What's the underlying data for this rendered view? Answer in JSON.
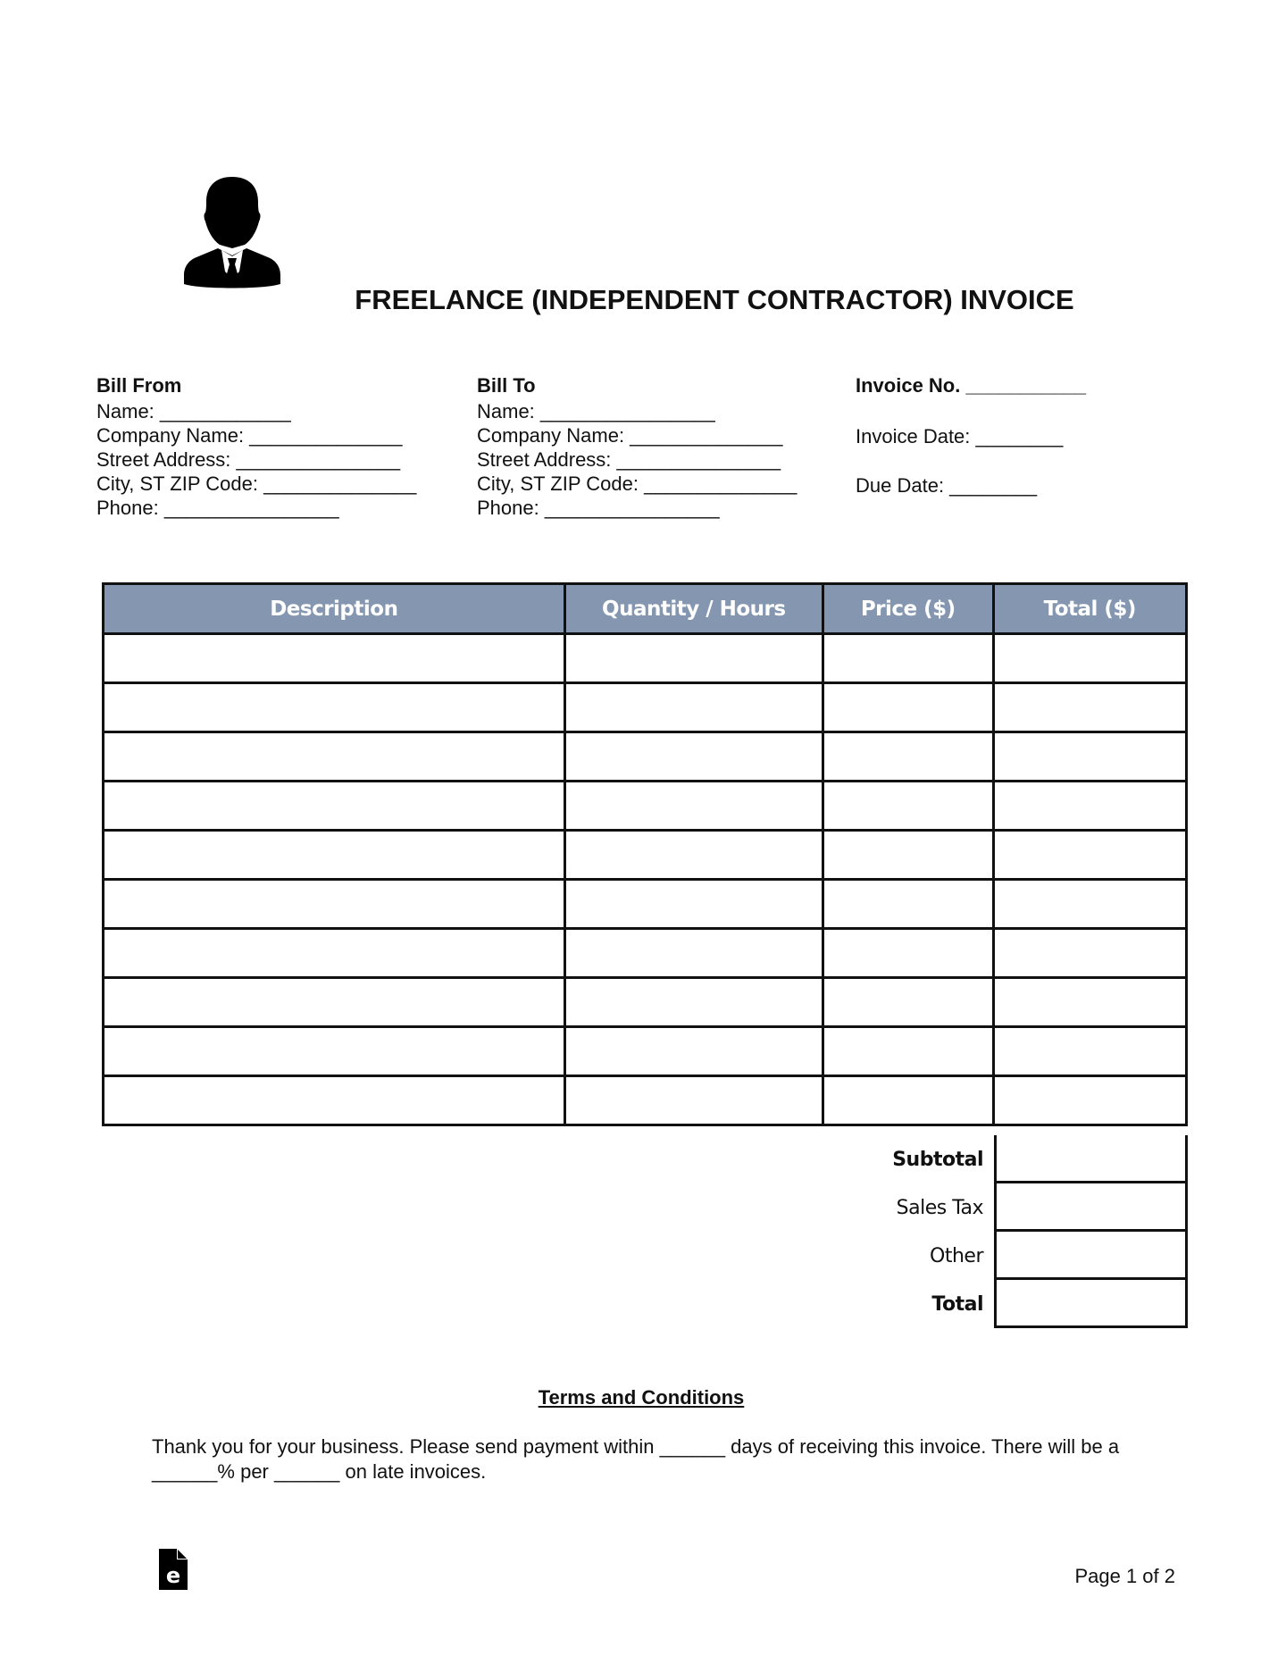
{
  "document": {
    "title": "FREELANCE (INDEPENDENT CONTRACTOR) INVOICE",
    "logo_icon": "person-in-suit-icon"
  },
  "bill_from": {
    "heading": "Bill From",
    "fields": [
      "Name: ____________",
      "Company Name: ______________",
      "Street Address: _______________",
      "City, ST ZIP Code: ______________",
      "Phone: ________________"
    ]
  },
  "bill_to": {
    "heading": "Bill To",
    "fields": [
      "Name: ________________",
      "Company Name: ______________",
      "Street Address: _______________",
      "City, ST ZIP Code: ______________",
      "Phone: ________________"
    ]
  },
  "invoice_meta": {
    "invoice_no": "Invoice No. ___________",
    "invoice_date": "Invoice Date: ________",
    "due_date": "Due Date: ________"
  },
  "items_table": {
    "header_color": "#8496b0",
    "columns": [
      "Description",
      "Quantity / Hours",
      "Price ($)",
      "Total ($)"
    ],
    "rows": [
      [
        "",
        "",
        "",
        ""
      ],
      [
        "",
        "",
        "",
        ""
      ],
      [
        "",
        "",
        "",
        ""
      ],
      [
        "",
        "",
        "",
        ""
      ],
      [
        "",
        "",
        "",
        ""
      ],
      [
        "",
        "",
        "",
        ""
      ],
      [
        "",
        "",
        "",
        ""
      ],
      [
        "",
        "",
        "",
        ""
      ],
      [
        "",
        "",
        "",
        ""
      ],
      [
        "",
        "",
        "",
        ""
      ]
    ]
  },
  "totals": {
    "subtotal_label": "Subtotal",
    "subtotal_value": "",
    "sales_tax_label": "Sales Tax",
    "sales_tax_value": "",
    "other_label": "Other",
    "other_value": "",
    "total_label": "Total",
    "total_value": ""
  },
  "terms": {
    "heading": "Terms and Conditions",
    "text": "Thank you for your business. Please send payment within ______ days of receiving this invoice. There will be a ______% per ______ on late invoices."
  },
  "footer": {
    "icon": "eforms-logo-icon",
    "page": "Page 1 of 2"
  }
}
